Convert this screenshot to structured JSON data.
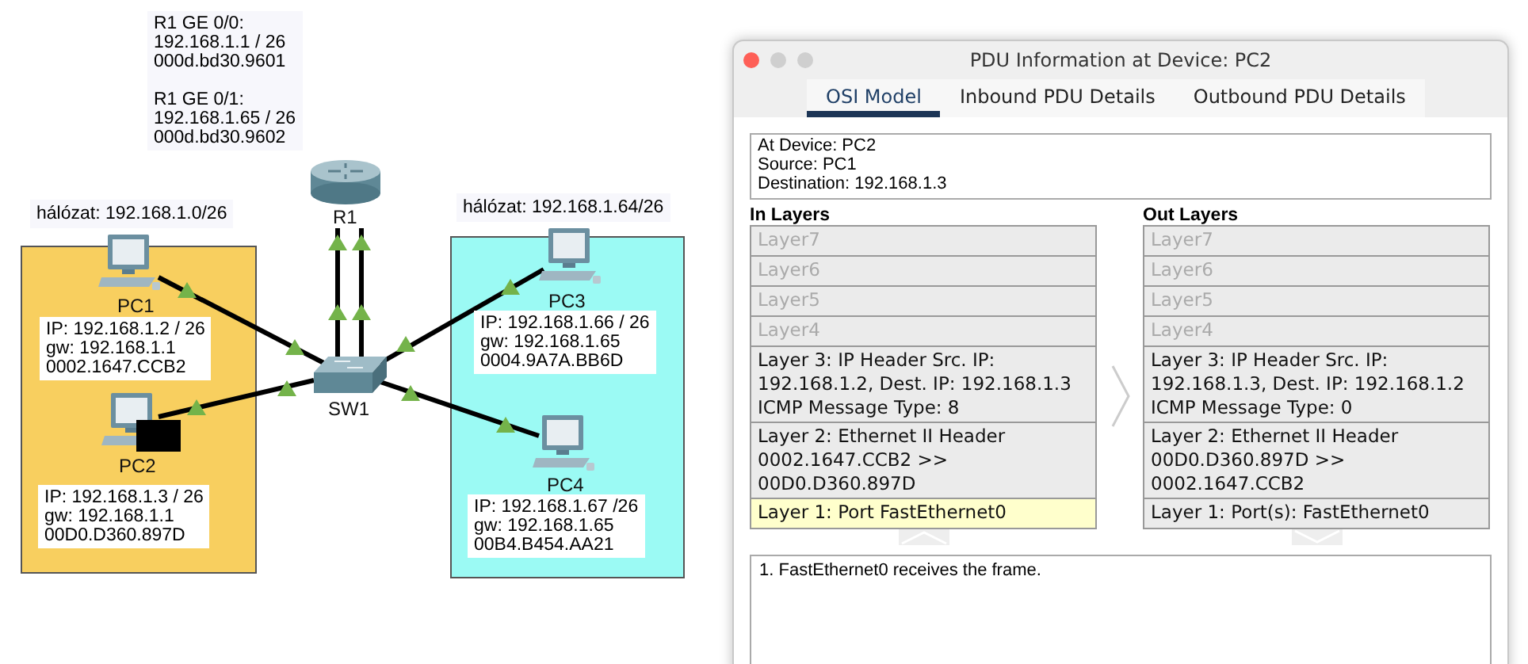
{
  "topology": {
    "notes": [
      "R1 GE 0/0:\n192.168.1.1 / 26\n000d.bd30.9601\n\nR1 GE 0/1:\n192.168.1.65 / 26\n000d.bd30.9602"
    ],
    "networks": [
      {
        "label": "hálózat: 192.168.1.0/26",
        "color": "#f8cf5f"
      },
      {
        "label": "hálózat: 192.168.1.64/26",
        "color": "#9bfaf4"
      }
    ],
    "devices": [
      {
        "kind": "router",
        "label": "R1"
      },
      {
        "kind": "pc",
        "label": "PC1",
        "info": "IP: 192.168.1.2 / 26\ngw: 192.168.1.1\n0002.1647.CCB2"
      },
      {
        "kind": "pc",
        "label": "PC2",
        "info": "IP: 192.168.1.3 / 26\ngw: 192.168.1.1\n00D0.D360.897D"
      },
      {
        "kind": "switch",
        "label": "SW1"
      },
      {
        "kind": "pc",
        "label": "PC3",
        "info": "IP: 192.168.1.66 / 26\ngw: 192.168.1.65\n0004.9A7A.BB6D"
      },
      {
        "kind": "pc",
        "label": "PC4",
        "info": "IP: 192.168.1.67 /26\ngw: 192.168.1.65\n00B4.B454.AA21"
      }
    ]
  },
  "dialog": {
    "title": "PDU Information at Device: PC2",
    "tabs": [
      {
        "label": "OSI Model",
        "selected": true
      },
      {
        "label": "Inbound PDU Details",
        "selected": false
      },
      {
        "label": "Outbound PDU Details",
        "selected": false
      }
    ],
    "info": "At Device: PC2\nSource: PC1\nDestination: 192.168.1.3",
    "in_layers": {
      "heading": "In Layers",
      "layers": [
        {
          "text": "Layer7",
          "disabled": true,
          "selected": false
        },
        {
          "text": "Layer6",
          "disabled": true,
          "selected": false
        },
        {
          "text": "Layer5",
          "disabled": true,
          "selected": false
        },
        {
          "text": "Layer4",
          "disabled": true,
          "selected": false
        },
        {
          "text": "Layer 3: IP Header Src. IP: 192.168.1.2, Dest. IP: 192.168.1.3 ICMP Message Type: 8",
          "disabled": false,
          "selected": false
        },
        {
          "text": "Layer 2: Ethernet II Header 0002.1647.CCB2 >> 00D0.D360.897D",
          "disabled": false,
          "selected": false
        },
        {
          "text": "Layer 1: Port FastEthernet0",
          "disabled": false,
          "selected": true
        }
      ]
    },
    "out_layers": {
      "heading": "Out Layers",
      "layers": [
        {
          "text": "Layer7",
          "disabled": true,
          "selected": false
        },
        {
          "text": "Layer6",
          "disabled": true,
          "selected": false
        },
        {
          "text": "Layer5",
          "disabled": true,
          "selected": false
        },
        {
          "text": "Layer4",
          "disabled": true,
          "selected": false
        },
        {
          "text": "Layer 3: IP Header Src. IP: 192.168.1.3, Dest. IP: 192.168.1.2 ICMP Message Type: 0",
          "disabled": false,
          "selected": false
        },
        {
          "text": "Layer 2: Ethernet II Header 00D0.D360.897D >> 0002.1647.CCB2",
          "disabled": false,
          "selected": false
        },
        {
          "text": "Layer 1: Port(s): FastEthernet0",
          "disabled": false,
          "selected": false
        }
      ]
    },
    "log": "1. FastEthernet0 receives the frame."
  }
}
